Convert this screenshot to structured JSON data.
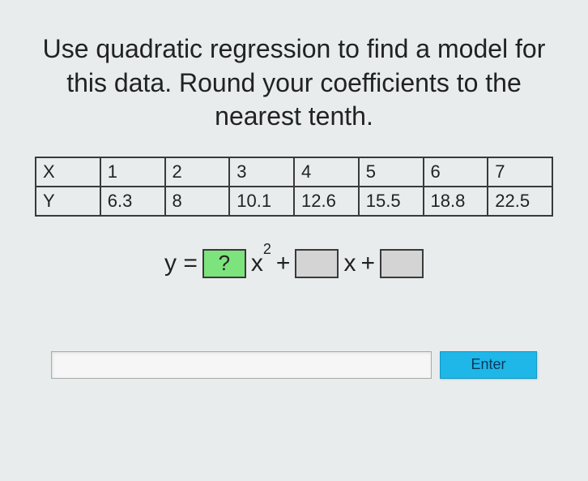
{
  "prompt": "Use quadratic regression to find a model for this data. Round your coefficients to the nearest tenth.",
  "table": {
    "row1_label": "X",
    "row2_label": "Y",
    "x": [
      "1",
      "2",
      "3",
      "4",
      "5",
      "6",
      "7"
    ],
    "y": [
      "6.3",
      "8",
      "10.1",
      "12.6",
      "15.5",
      "18.8",
      "22.5"
    ]
  },
  "equation": {
    "y_equals": "y =",
    "coef_a": "?",
    "x_squared": "x",
    "squared_exp": "2",
    "plus1": "+",
    "coef_b": " ",
    "x_term": "x",
    "plus2": "+",
    "coef_c": " "
  },
  "answer_input_value": "",
  "enter_label": "Enter"
}
